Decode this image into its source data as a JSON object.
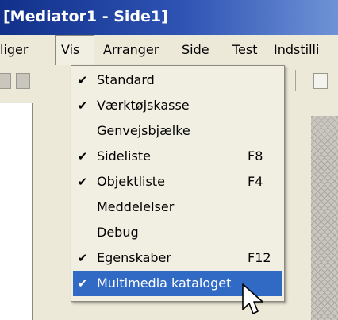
{
  "window": {
    "title": "[Mediator1 - Side1]"
  },
  "menubar": {
    "items": [
      {
        "label": "liger"
      },
      {
        "label": "Vis",
        "open": true
      },
      {
        "label": "Arranger"
      },
      {
        "label": "Side"
      },
      {
        "label": "Test"
      },
      {
        "label": "Indstilli"
      }
    ]
  },
  "dropdown": {
    "check_glyph": "✔",
    "items": [
      {
        "label": "Standard",
        "checked": true,
        "shortcut": ""
      },
      {
        "label": "Værktøjskasse",
        "checked": true,
        "shortcut": ""
      },
      {
        "label": "Genvejsbjælke",
        "checked": false,
        "shortcut": ""
      },
      {
        "label": "Sideliste",
        "checked": true,
        "shortcut": "F8"
      },
      {
        "label": "Objektliste",
        "checked": true,
        "shortcut": "F4"
      },
      {
        "label": "Meddelelser",
        "checked": false,
        "shortcut": ""
      },
      {
        "label": "Debug",
        "checked": false,
        "shortcut": ""
      },
      {
        "label": "Egenskaber",
        "checked": true,
        "shortcut": "F12"
      },
      {
        "label": "Multimedia kataloget",
        "checked": true,
        "shortcut": "",
        "highlighted": true
      }
    ]
  },
  "colors": {
    "titlebar": "#11308a",
    "menubar": "#ece9d8",
    "menu_bg": "#f1efe2",
    "highlight": "#316ac5",
    "highlight_text": "#ffffff"
  },
  "icons": {
    "cursor": "arrow-cursor-icon",
    "toolbar": [
      "clipboard-icon",
      "paste-icon",
      "toolbar-button-icon"
    ]
  }
}
